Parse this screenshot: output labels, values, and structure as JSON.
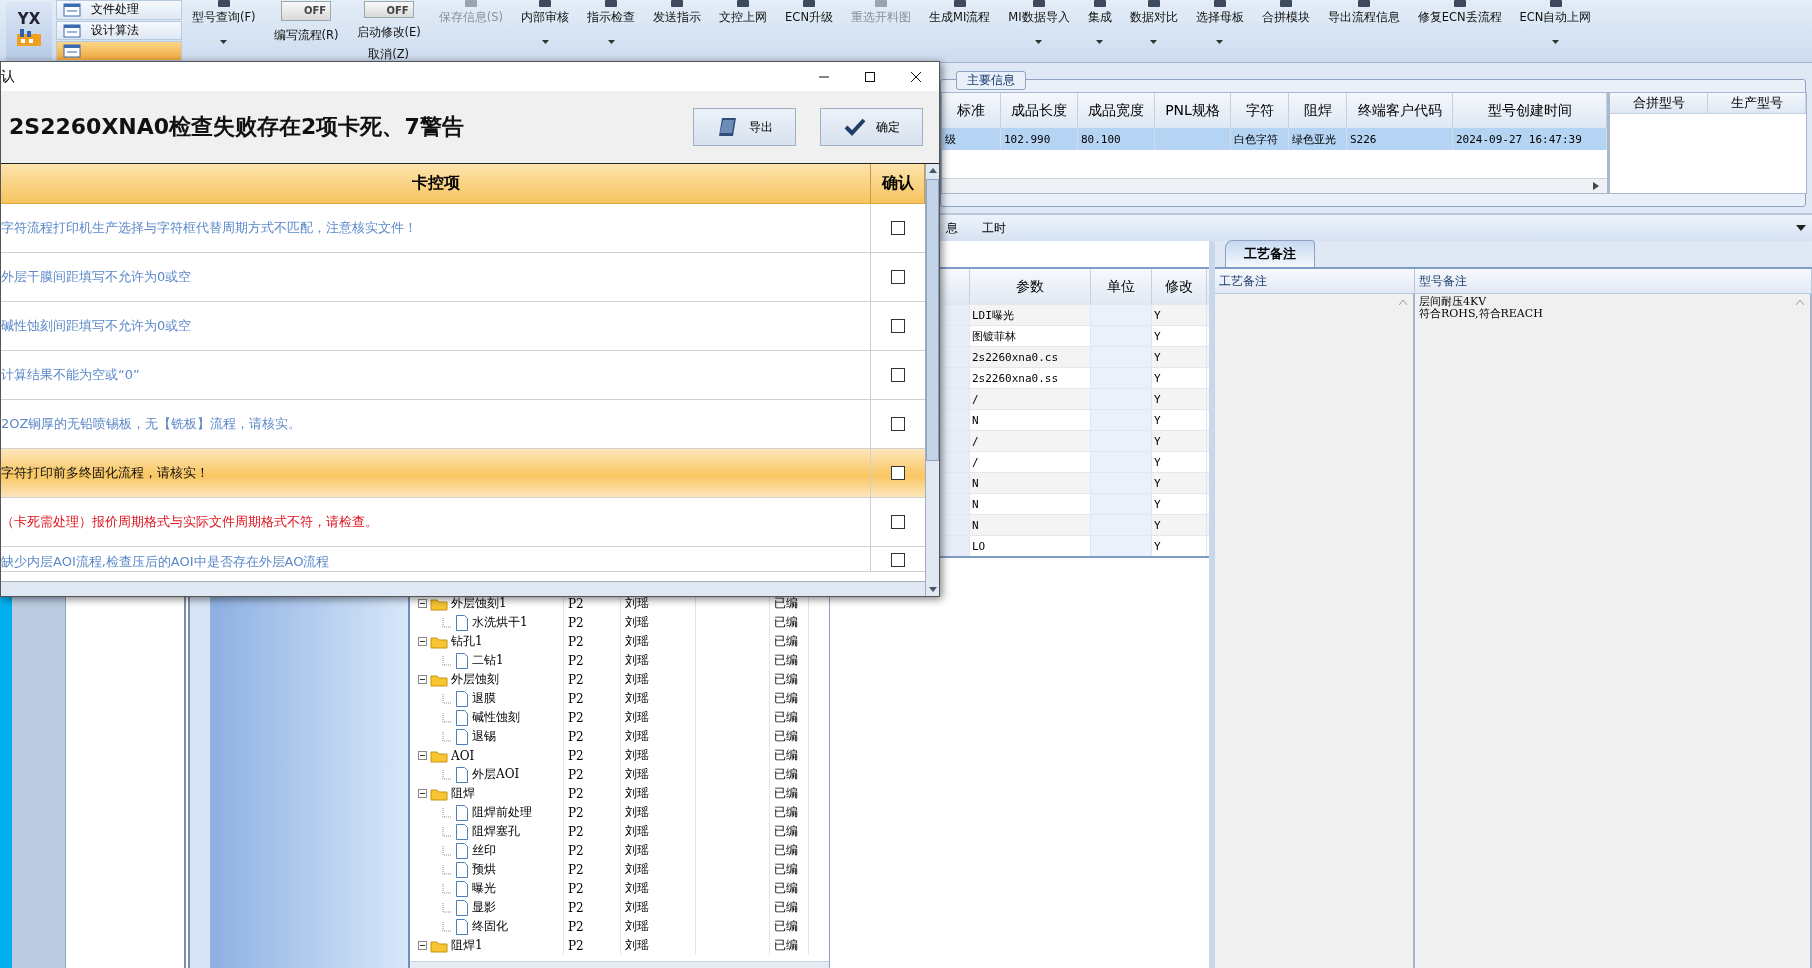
{
  "toolbar": {
    "logo": "YX",
    "side_items": [
      {
        "label": "文件处理",
        "selected": false
      },
      {
        "label": "设计算法",
        "selected": false
      },
      {
        "selected": true
      }
    ],
    "buttons": [
      {
        "kind": "button",
        "label": "型号查询(F)",
        "dropdown": true,
        "disabled": false
      },
      {
        "kind": "toggle",
        "state": "OFF",
        "label": "编写流程(R)"
      },
      {
        "kind": "toggle",
        "state": "OFF",
        "label": "启动修改(E)",
        "sublabel": "取消(Z)"
      },
      {
        "kind": "button",
        "label": "保存信息(S)",
        "dropdown": false,
        "disabled": true
      },
      {
        "kind": "button",
        "label": "内部审核",
        "dropdown": true,
        "disabled": false
      },
      {
        "kind": "button",
        "label": "指示检查",
        "dropdown": true,
        "disabled": false
      },
      {
        "kind": "button",
        "label": "发送指示",
        "dropdown": false,
        "disabled": false
      },
      {
        "kind": "button",
        "label": "文控上网",
        "dropdown": false,
        "disabled": false
      },
      {
        "kind": "button",
        "label": "ECN升级",
        "dropdown": false,
        "disabled": false
      },
      {
        "kind": "button",
        "label": "重选开料图",
        "dropdown": false,
        "disabled": true
      },
      {
        "kind": "button",
        "label": "生成MI流程",
        "dropdown": false,
        "disabled": false
      },
      {
        "kind": "button",
        "label": "MI数据导入",
        "dropdown": true,
        "disabled": false
      },
      {
        "kind": "button",
        "label": "集成",
        "dropdown": true,
        "disabled": false
      },
      {
        "kind": "button",
        "label": "数据对比",
        "dropdown": true,
        "disabled": false
      },
      {
        "kind": "button",
        "label": "选择母板",
        "dropdown": true,
        "disabled": false
      },
      {
        "kind": "button",
        "label": "合拼模块",
        "dropdown": false,
        "disabled": false
      },
      {
        "kind": "button",
        "label": "导出流程信息",
        "dropdown": false,
        "disabled": false
      },
      {
        "kind": "button",
        "label": "修复ECN丢流程",
        "dropdown": false,
        "disabled": false
      },
      {
        "kind": "button",
        "label": "ECN自动上网",
        "dropdown": true,
        "disabled": false
      }
    ]
  },
  "main_info": {
    "title": "主要信息",
    "columns": [
      "标准",
      "成品长度",
      "成品宽度",
      "PNL规格",
      "字符",
      "阻焊",
      "终端客户代码",
      "型号创建时间"
    ],
    "rows": [
      {
        "selected": true,
        "cells": [
          "级",
          "102.990",
          "80.100",
          "",
          "白色字符",
          "绿色亚光",
          "S226",
          "2024-09-27 16:47:39"
        ]
      }
    ],
    "side_columns": [
      "合拼型号",
      "生产型号"
    ]
  },
  "detail_tabs": [
    {
      "label": "息",
      "selected": false
    },
    {
      "label": "工时",
      "selected": false
    }
  ],
  "params": {
    "columns": [
      "参数",
      "单位",
      "修改"
    ],
    "rows": [
      {
        "value": "LDI曝光",
        "modify": "Y"
      },
      {
        "value": "图镀菲林",
        "modify": "Y"
      },
      {
        "value": "2s2260xna0.cs",
        "modify": "Y"
      },
      {
        "value": "2s2260xna0.ss",
        "modify": "Y"
      },
      {
        "value": "/",
        "modify": "Y"
      },
      {
        "value": "N",
        "modify": "Y"
      },
      {
        "value": "/",
        "modify": "Y"
      },
      {
        "value": "/",
        "modify": "Y"
      },
      {
        "value": "N",
        "modify": "Y"
      },
      {
        "value": "N",
        "modify": "Y"
      },
      {
        "value": "N",
        "modify": "Y"
      },
      {
        "value": "LO",
        "modify": "Y"
      }
    ]
  },
  "notes": {
    "tabs": [
      {
        "label": "工艺备注",
        "selected": true
      }
    ],
    "columns": [
      "工艺备注",
      "型号备注"
    ],
    "model_note": [
      "层间耐压4KV",
      "符合ROHS,符合REACH"
    ]
  },
  "tree": {
    "nodes": [
      {
        "name": "外层蚀刻1",
        "column_2": "P2",
        "column_3": "刘瑶",
        "column_5": "已编",
        "expanded": true,
        "children": [
          {
            "name": "水洗烘干1",
            "column_2": "P2",
            "column_3": "刘瑶",
            "column_5": "已编"
          }
        ]
      },
      {
        "name": "钻孔1",
        "column_2": "P2",
        "column_3": "刘瑶",
        "column_5": "已编",
        "expanded": true,
        "children": [
          {
            "name": "二钻1",
            "column_2": "P2",
            "column_3": "刘瑶",
            "column_5": "已编"
          }
        ]
      },
      {
        "name": "外层蚀刻",
        "column_2": "P2",
        "column_3": "刘瑶",
        "column_5": "已编",
        "expanded": true,
        "children": [
          {
            "name": "退膜",
            "column_2": "P2",
            "column_3": "刘瑶",
            "column_5": "已编"
          },
          {
            "name": "碱性蚀刻",
            "column_2": "P2",
            "column_3": "刘瑶",
            "column_5": "已编"
          },
          {
            "name": "退锡",
            "column_2": "P2",
            "column_3": "刘瑶",
            "column_5": "已编"
          }
        ]
      },
      {
        "name": "AOI",
        "column_2": "P2",
        "column_3": "刘瑶",
        "column_5": "已编",
        "expanded": true,
        "children": [
          {
            "name": "外层AOI",
            "column_2": "P2",
            "column_3": "刘瑶",
            "column_5": "已编"
          }
        ]
      },
      {
        "name": "阻焊",
        "column_2": "P2",
        "column_3": "刘瑶",
        "column_5": "已编",
        "expanded": true,
        "children": [
          {
            "name": "阻焊前处理",
            "column_2": "P2",
            "column_3": "刘瑶",
            "column_5": "已编"
          },
          {
            "name": "阻焊塞孔",
            "column_2": "P2",
            "column_3": "刘瑶",
            "column_5": "已编"
          },
          {
            "name": "丝印",
            "column_2": "P2",
            "column_3": "刘瑶",
            "column_5": "已编"
          },
          {
            "name": "预烘",
            "column_2": "P2",
            "column_3": "刘瑶",
            "column_5": "已编"
          },
          {
            "name": "曝光",
            "column_2": "P2",
            "column_3": "刘瑶",
            "column_5": "已编"
          },
          {
            "name": "显影",
            "column_2": "P2",
            "column_3": "刘瑶",
            "column_5": "已编"
          },
          {
            "name": "终固化",
            "column_2": "P2",
            "column_3": "刘瑶",
            "column_5": "已编"
          }
        ]
      },
      {
        "name": "阻焊1",
        "column_2": "P2",
        "column_3": "刘瑶",
        "column_5": "已编",
        "expanded": true
      }
    ]
  },
  "dialog": {
    "title": "认",
    "heading": "2S2260XNA0检查失败存在2项卡死、7警告",
    "buttons": [
      {
        "kind": "export",
        "label": "导出"
      },
      {
        "kind": "confirm",
        "label": "确定"
      }
    ],
    "columns": [
      "卡控项",
      "确认"
    ],
    "rows": [
      {
        "kind": "warning",
        "text": "字符流程打印机生产选择与字符框代替周期方式不匹配，注意核实文件！",
        "checked": false,
        "selected": false
      },
      {
        "kind": "warning",
        "text": "外层干膜间距填写不允许为0或空",
        "checked": false,
        "selected": false
      },
      {
        "kind": "warning",
        "text": "碱性蚀刻间距填写不允许为0或空",
        "checked": false,
        "selected": false
      },
      {
        "kind": "warning",
        "text": "计算结果不能为空或“0”",
        "checked": false,
        "selected": false
      },
      {
        "kind": "warning",
        "text": "2OZ铜厚的无铅喷锡板，无【铣板】流程，请核实。",
        "checked": false,
        "selected": false
      },
      {
        "kind": "warning",
        "text": "字符打印前多终固化流程，请核实！",
        "checked": false,
        "selected": true
      },
      {
        "kind": "fatal",
        "text": "（卡死需处理）报价周期格式与实际文件周期格式不符，请检查。",
        "checked": false,
        "selected": false
      },
      {
        "kind": "warning",
        "text": "缺少内层AOI流程,检查压后的AOI中是否存在外层AO流程",
        "checked": false,
        "selected": false
      }
    ]
  }
}
